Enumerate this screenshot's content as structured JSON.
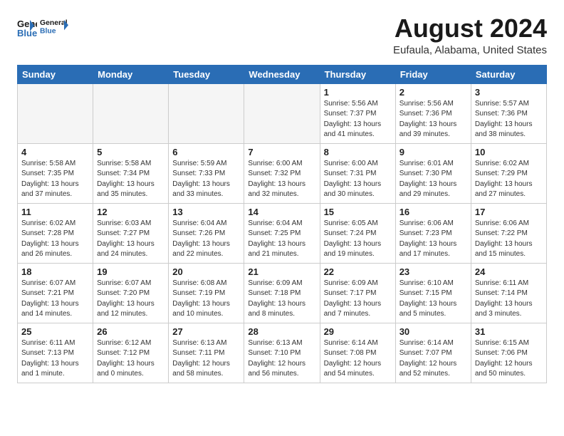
{
  "header": {
    "logo_line1": "General",
    "logo_line2": "Blue",
    "month_title": "August 2024",
    "location": "Eufaula, Alabama, United States"
  },
  "weekdays": [
    "Sunday",
    "Monday",
    "Tuesday",
    "Wednesday",
    "Thursday",
    "Friday",
    "Saturday"
  ],
  "weeks": [
    [
      {
        "day": "",
        "empty": true
      },
      {
        "day": "",
        "empty": true
      },
      {
        "day": "",
        "empty": true
      },
      {
        "day": "",
        "empty": true
      },
      {
        "day": "1",
        "sunrise": "Sunrise: 5:56 AM",
        "sunset": "Sunset: 7:37 PM",
        "daylight": "Daylight: 13 hours and 41 minutes."
      },
      {
        "day": "2",
        "sunrise": "Sunrise: 5:56 AM",
        "sunset": "Sunset: 7:36 PM",
        "daylight": "Daylight: 13 hours and 39 minutes."
      },
      {
        "day": "3",
        "sunrise": "Sunrise: 5:57 AM",
        "sunset": "Sunset: 7:36 PM",
        "daylight": "Daylight: 13 hours and 38 minutes."
      }
    ],
    [
      {
        "day": "4",
        "sunrise": "Sunrise: 5:58 AM",
        "sunset": "Sunset: 7:35 PM",
        "daylight": "Daylight: 13 hours and 37 minutes."
      },
      {
        "day": "5",
        "sunrise": "Sunrise: 5:58 AM",
        "sunset": "Sunset: 7:34 PM",
        "daylight": "Daylight: 13 hours and 35 minutes."
      },
      {
        "day": "6",
        "sunrise": "Sunrise: 5:59 AM",
        "sunset": "Sunset: 7:33 PM",
        "daylight": "Daylight: 13 hours and 33 minutes."
      },
      {
        "day": "7",
        "sunrise": "Sunrise: 6:00 AM",
        "sunset": "Sunset: 7:32 PM",
        "daylight": "Daylight: 13 hours and 32 minutes."
      },
      {
        "day": "8",
        "sunrise": "Sunrise: 6:00 AM",
        "sunset": "Sunset: 7:31 PM",
        "daylight": "Daylight: 13 hours and 30 minutes."
      },
      {
        "day": "9",
        "sunrise": "Sunrise: 6:01 AM",
        "sunset": "Sunset: 7:30 PM",
        "daylight": "Daylight: 13 hours and 29 minutes."
      },
      {
        "day": "10",
        "sunrise": "Sunrise: 6:02 AM",
        "sunset": "Sunset: 7:29 PM",
        "daylight": "Daylight: 13 hours and 27 minutes."
      }
    ],
    [
      {
        "day": "11",
        "sunrise": "Sunrise: 6:02 AM",
        "sunset": "Sunset: 7:28 PM",
        "daylight": "Daylight: 13 hours and 26 minutes."
      },
      {
        "day": "12",
        "sunrise": "Sunrise: 6:03 AM",
        "sunset": "Sunset: 7:27 PM",
        "daylight": "Daylight: 13 hours and 24 minutes."
      },
      {
        "day": "13",
        "sunrise": "Sunrise: 6:04 AM",
        "sunset": "Sunset: 7:26 PM",
        "daylight": "Daylight: 13 hours and 22 minutes."
      },
      {
        "day": "14",
        "sunrise": "Sunrise: 6:04 AM",
        "sunset": "Sunset: 7:25 PM",
        "daylight": "Daylight: 13 hours and 21 minutes."
      },
      {
        "day": "15",
        "sunrise": "Sunrise: 6:05 AM",
        "sunset": "Sunset: 7:24 PM",
        "daylight": "Daylight: 13 hours and 19 minutes."
      },
      {
        "day": "16",
        "sunrise": "Sunrise: 6:06 AM",
        "sunset": "Sunset: 7:23 PM",
        "daylight": "Daylight: 13 hours and 17 minutes."
      },
      {
        "day": "17",
        "sunrise": "Sunrise: 6:06 AM",
        "sunset": "Sunset: 7:22 PM",
        "daylight": "Daylight: 13 hours and 15 minutes."
      }
    ],
    [
      {
        "day": "18",
        "sunrise": "Sunrise: 6:07 AM",
        "sunset": "Sunset: 7:21 PM",
        "daylight": "Daylight: 13 hours and 14 minutes."
      },
      {
        "day": "19",
        "sunrise": "Sunrise: 6:07 AM",
        "sunset": "Sunset: 7:20 PM",
        "daylight": "Daylight: 13 hours and 12 minutes."
      },
      {
        "day": "20",
        "sunrise": "Sunrise: 6:08 AM",
        "sunset": "Sunset: 7:19 PM",
        "daylight": "Daylight: 13 hours and 10 minutes."
      },
      {
        "day": "21",
        "sunrise": "Sunrise: 6:09 AM",
        "sunset": "Sunset: 7:18 PM",
        "daylight": "Daylight: 13 hours and 8 minutes."
      },
      {
        "day": "22",
        "sunrise": "Sunrise: 6:09 AM",
        "sunset": "Sunset: 7:17 PM",
        "daylight": "Daylight: 13 hours and 7 minutes."
      },
      {
        "day": "23",
        "sunrise": "Sunrise: 6:10 AM",
        "sunset": "Sunset: 7:15 PM",
        "daylight": "Daylight: 13 hours and 5 minutes."
      },
      {
        "day": "24",
        "sunrise": "Sunrise: 6:11 AM",
        "sunset": "Sunset: 7:14 PM",
        "daylight": "Daylight: 13 hours and 3 minutes."
      }
    ],
    [
      {
        "day": "25",
        "sunrise": "Sunrise: 6:11 AM",
        "sunset": "Sunset: 7:13 PM",
        "daylight": "Daylight: 13 hours and 1 minute."
      },
      {
        "day": "26",
        "sunrise": "Sunrise: 6:12 AM",
        "sunset": "Sunset: 7:12 PM",
        "daylight": "Daylight: 13 hours and 0 minutes."
      },
      {
        "day": "27",
        "sunrise": "Sunrise: 6:13 AM",
        "sunset": "Sunset: 7:11 PM",
        "daylight": "Daylight: 12 hours and 58 minutes."
      },
      {
        "day": "28",
        "sunrise": "Sunrise: 6:13 AM",
        "sunset": "Sunset: 7:10 PM",
        "daylight": "Daylight: 12 hours and 56 minutes."
      },
      {
        "day": "29",
        "sunrise": "Sunrise: 6:14 AM",
        "sunset": "Sunset: 7:08 PM",
        "daylight": "Daylight: 12 hours and 54 minutes."
      },
      {
        "day": "30",
        "sunrise": "Sunrise: 6:14 AM",
        "sunset": "Sunset: 7:07 PM",
        "daylight": "Daylight: 12 hours and 52 minutes."
      },
      {
        "day": "31",
        "sunrise": "Sunrise: 6:15 AM",
        "sunset": "Sunset: 7:06 PM",
        "daylight": "Daylight: 12 hours and 50 minutes."
      }
    ]
  ]
}
